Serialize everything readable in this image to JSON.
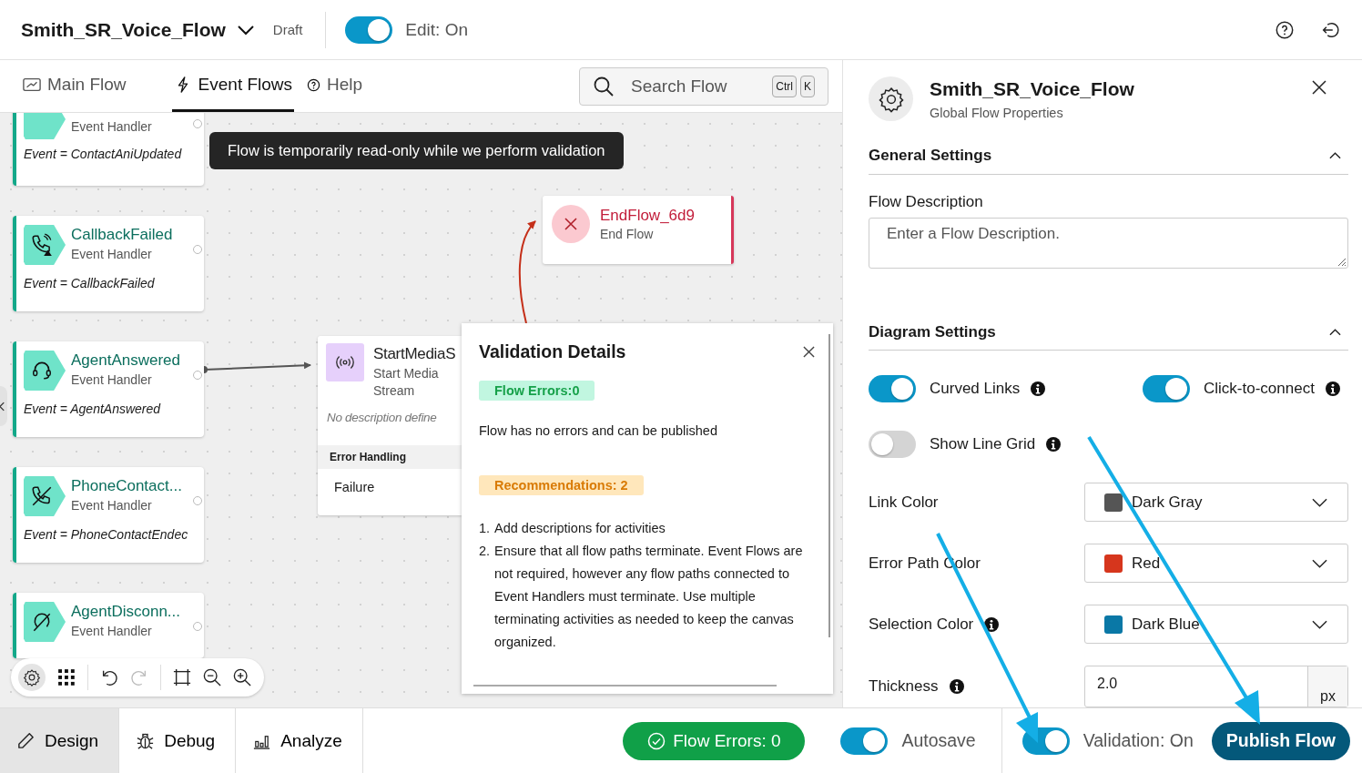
{
  "header": {
    "title": "Smith_SR_Voice_Flow",
    "status": "Draft",
    "edit": {
      "label": "Edit: On",
      "on": true
    }
  },
  "tabs": [
    {
      "label": "Main Flow",
      "kind": "flow",
      "selected": false
    },
    {
      "label": "Event Flows",
      "kind": "bolt",
      "selected": true
    },
    {
      "label": "Help",
      "kind": "help",
      "selected": false
    }
  ],
  "search": {
    "placeholder": "Search Flow",
    "keys": [
      "Ctrl",
      "K"
    ]
  },
  "canvas": {
    "notice": "Flow is temporarily read-only while we perform validation",
    "event_handlers": [
      {
        "kind": "generic",
        "subtitle": "Event Handler",
        "event": "Event = ContactAniUpdated"
      },
      {
        "kind": "callback",
        "title": "CallbackFailed",
        "subtitle": "Event Handler",
        "event": "Event = CallbackFailed"
      },
      {
        "kind": "headset",
        "title": "AgentAnswered",
        "subtitle": "Event Handler",
        "event": "Event = AgentAnswered"
      },
      {
        "kind": "phone-cross",
        "title": "PhoneContact...",
        "subtitle": "Event Handler",
        "event": "Event = PhoneContactEndec"
      },
      {
        "kind": "phone-off",
        "title": "AgentDisconn...",
        "subtitle": "Event Handler"
      }
    ],
    "activity": {
      "title": "StartMediaS",
      "subtitle": "Start Media Stream",
      "description": "No description define",
      "section": "Error Handling",
      "outcome": "Failure"
    },
    "end_node": {
      "title": "EndFlow_6d9",
      "subtitle": "End Flow"
    }
  },
  "validation": {
    "title": "Validation Details",
    "errors_badge": "Flow Errors:0",
    "message": "Flow has no errors and can be published",
    "recommendations_badge": "Recommendations: 2",
    "recommendations": [
      {
        "number": "1.",
        "text": "Add descriptions for activities"
      },
      {
        "number": "2.",
        "text": "Ensure that all flow paths terminate. Event Flows are not required, however any flow paths connected to Event Handlers must terminate. Use multiple terminating activities as needed to keep the canvas organized."
      }
    ]
  },
  "properties": {
    "title": "Smith_SR_Voice_Flow",
    "subtitle": "Global Flow Properties",
    "general": {
      "title": "General Settings",
      "expanded": true,
      "description_label": "Flow Description",
      "description_placeholder": "Enter a Flow Description."
    },
    "diagram": {
      "title": "Diagram Settings",
      "expanded": true,
      "toggles": [
        {
          "label": "Curved Links",
          "on": true
        },
        {
          "label": "Click-to-connect",
          "on": true
        },
        {
          "label": "Show Line Grid",
          "on": false
        }
      ],
      "selects": [
        {
          "label": "Link Color",
          "info": false,
          "value": "Dark Gray",
          "color": "#555555"
        },
        {
          "label": "Error Path Color",
          "info": false,
          "value": "Red",
          "color": "#d6361d"
        },
        {
          "label": "Selection Color",
          "info": true,
          "value": "Dark Blue",
          "color": "#0a78a6"
        }
      ],
      "thickness": {
        "label": "Thickness",
        "value": "2.0",
        "unit": "px"
      }
    }
  },
  "bottom_bar": {
    "modes": [
      {
        "label": "Design",
        "kind": "pencil",
        "selected": true
      },
      {
        "label": "Debug",
        "kind": "bug",
        "selected": false
      },
      {
        "label": "Analyze",
        "kind": "chart",
        "selected": false
      }
    ],
    "errors_button": "Flow Errors: 0",
    "autosave": {
      "label": "Autosave",
      "on": true
    },
    "validation": {
      "label": "Validation: On",
      "on": true
    },
    "publish": "Publish Flow"
  }
}
